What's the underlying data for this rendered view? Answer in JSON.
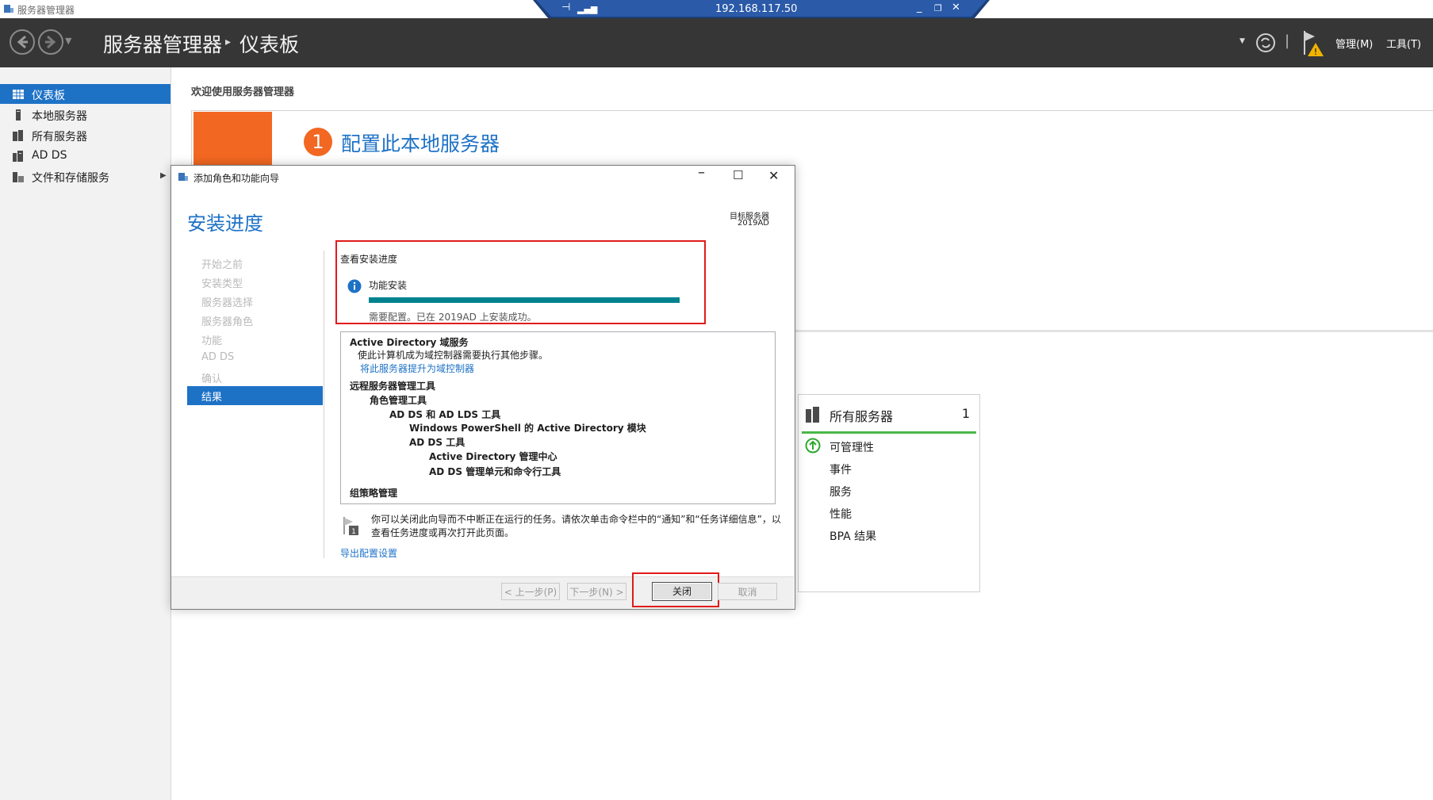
{
  "window": {
    "title": "服务器管理器"
  },
  "rdp": {
    "ip": "192.168.117.50",
    "pin_icon": "pin-icon",
    "signal_icon": "signal-icon"
  },
  "header": {
    "app_title": "服务器管理器",
    "page_title": "仪表板",
    "menu": {
      "manage": "管理(M)",
      "tools": "工具(T)"
    }
  },
  "sidebar": {
    "items": [
      {
        "label": "仪表板",
        "icon": "dashboard-icon",
        "active": true
      },
      {
        "label": "本地服务器",
        "icon": "server-icon"
      },
      {
        "label": "所有服务器",
        "icon": "servers-icon"
      },
      {
        "label": "AD DS",
        "icon": "ad-ds-icon"
      },
      {
        "label": "文件和存储服务",
        "icon": "storage-icon"
      }
    ]
  },
  "main": {
    "welcome": "欢迎使用服务器管理器",
    "quickstart": {
      "step_number": "1",
      "step_title": "配置此本地服务器"
    }
  },
  "tile": {
    "title": "所有服务器",
    "count": "1",
    "rows": [
      "可管理性",
      "事件",
      "服务",
      "性能",
      "BPA 结果"
    ]
  },
  "dialog": {
    "title": "添加角色和功能向导",
    "heading": "安装进度",
    "target_label": "目标服务器",
    "target_name": "2019AD",
    "steps": [
      "开始之前",
      "安装类型",
      "服务器选择",
      "服务器角色",
      "功能",
      "AD DS",
      "确认",
      "结果"
    ],
    "progress": {
      "section_title": "查看安装进度",
      "feature_label": "功能安装",
      "status": "需要配置。已在 2019AD 上安装成功。",
      "percent": 100
    },
    "results": {
      "adds_title": "Active Directory 域服务",
      "adds_desc": "使此计算机成为域控制器需要执行其他步骤。",
      "adds_link": "将此服务器提升为域控制器",
      "rsat": "远程服务器管理工具",
      "role_tools": "角色管理工具",
      "adds_lds_tools": "AD DS 和 AD LDS 工具",
      "ps_module": "Windows PowerShell 的 Active Directory 模块",
      "adds_tools": "AD DS 工具",
      "adac": "Active Directory 管理中心",
      "snapins": "AD DS 管理单元和命令行工具",
      "gpm": "组策略管理"
    },
    "note": "你可以关闭此向导而不中断正在运行的任务。请依次单击命令栏中的“通知”和“任务详细信息”，以查看任务进度或再次打开此页面。",
    "export_link": "导出配置设置",
    "buttons": {
      "prev": "< 上一步(P)",
      "next": "下一步(N) >",
      "close": "关闭",
      "cancel": "取消"
    }
  }
}
